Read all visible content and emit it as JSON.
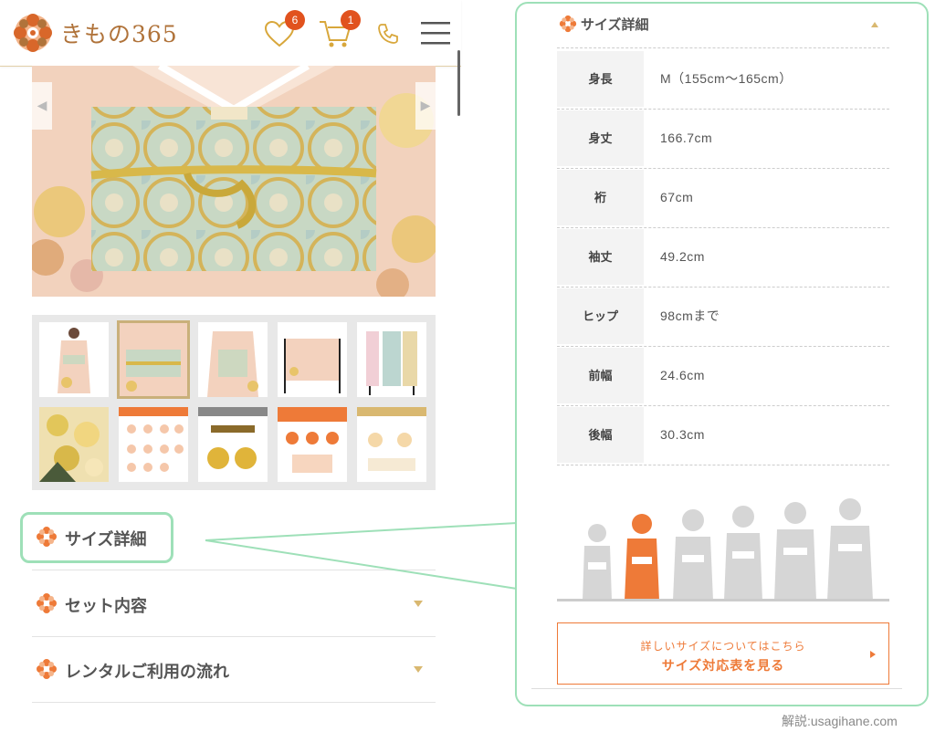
{
  "header": {
    "logo_text": "きもの365",
    "favorites_count": "6",
    "cart_count": "1",
    "icons": [
      "heart-icon",
      "cart-icon",
      "phone-icon",
      "menu-icon"
    ]
  },
  "gallery": {
    "prev_arrow": "◀",
    "next_arrow": "▶",
    "thumbnails": [
      {
        "name": "kimono-full-front"
      },
      {
        "name": "kimono-obi-closeup"
      },
      {
        "name": "kimono-back-obi"
      },
      {
        "name": "kimono-spread"
      },
      {
        "name": "kimono-accessories"
      },
      {
        "name": "kimono-pattern"
      },
      {
        "name": "rental-info-1"
      },
      {
        "name": "rental-info-2"
      },
      {
        "name": "rental-info-3"
      },
      {
        "name": "rental-info-4"
      }
    ]
  },
  "accordion": {
    "items": [
      {
        "label": "サイズ詳細"
      },
      {
        "label": "セット内容"
      },
      {
        "label": "レンタルご利用の流れ"
      }
    ]
  },
  "panel": {
    "title": "サイズ詳細",
    "rows": [
      {
        "key": "身長",
        "value": "M（155cm〜165cm）"
      },
      {
        "key": "身丈",
        "value": "166.7cm"
      },
      {
        "key": "裄",
        "value": "67cm"
      },
      {
        "key": "袖丈",
        "value": "49.2cm"
      },
      {
        "key": "ヒップ",
        "value": "98cmまで"
      },
      {
        "key": "前幅",
        "value": "24.6cm"
      },
      {
        "key": "後幅",
        "value": "30.3cm"
      }
    ],
    "size_figures": [
      "S",
      "M",
      "L",
      "LL",
      "3L",
      "4L"
    ],
    "selected_figure": "M",
    "cta_sub": "詳しいサイズについてはこちら",
    "cta_main": "サイズ対応表を見る"
  },
  "credit": "解説:usagihane.com",
  "colors": {
    "accent": "#ee7a38",
    "badge": "#e1521e",
    "highlight": "#9ee0b8",
    "gold": "#d9b870"
  }
}
